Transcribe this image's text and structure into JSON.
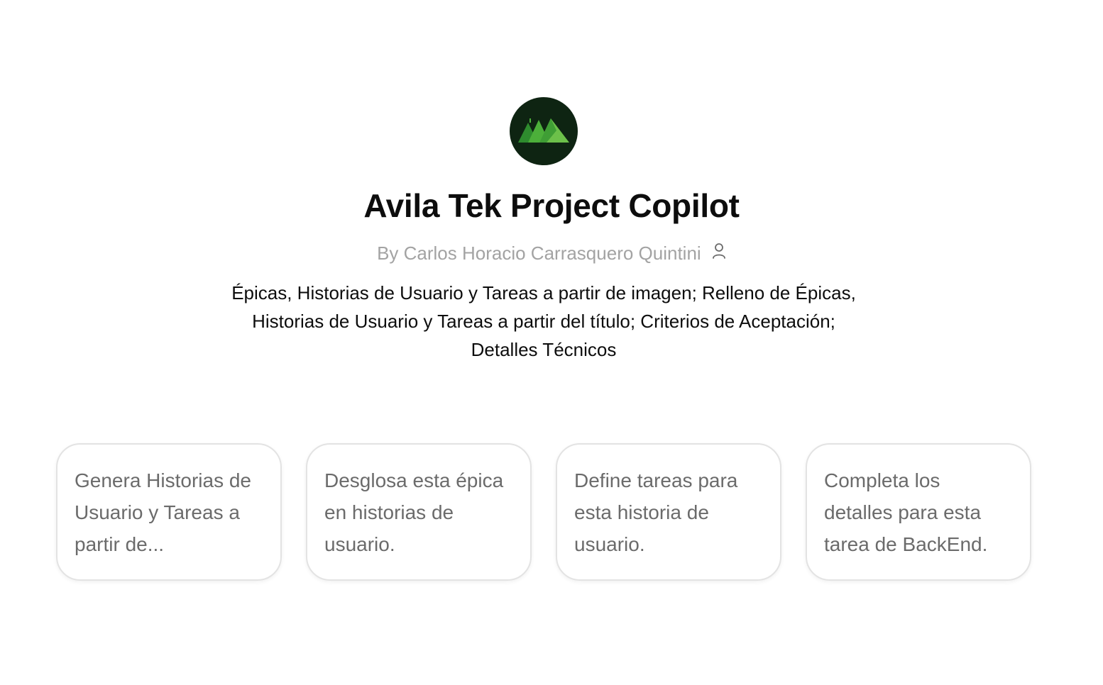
{
  "gpt": {
    "logo_icon": "green-mountains-logo",
    "name": "Avila Tek Project Copilot",
    "byline": "By Carlos Horacio Carrasquero Quintini",
    "byline_icon": "person-icon",
    "description": "Épicas, Historias de Usuario y Tareas a partir de imagen; Relleno de Épicas, Historias de Usuario y Tareas a partir del título; Criterios de Aceptación; Detalles Técnicos"
  },
  "conversation_starters": [
    {
      "text": "Genera Historias de Usuario y Tareas a partir de..."
    },
    {
      "text": "Desglosa esta épica en historias de usuario."
    },
    {
      "text": "Define tareas para esta historia de usuario."
    },
    {
      "text": "Completa los detalles para esta tarea de BackEnd."
    }
  ],
  "colors": {
    "logo_background": "#0e2412",
    "logo_green_light": "#6cc04a",
    "logo_green_dark": "#2e8b2e",
    "title_text": "#0d0d0d",
    "byline_text": "#a3a3a3",
    "card_border": "#e3e3e3",
    "card_text": "#6b6b6b"
  }
}
